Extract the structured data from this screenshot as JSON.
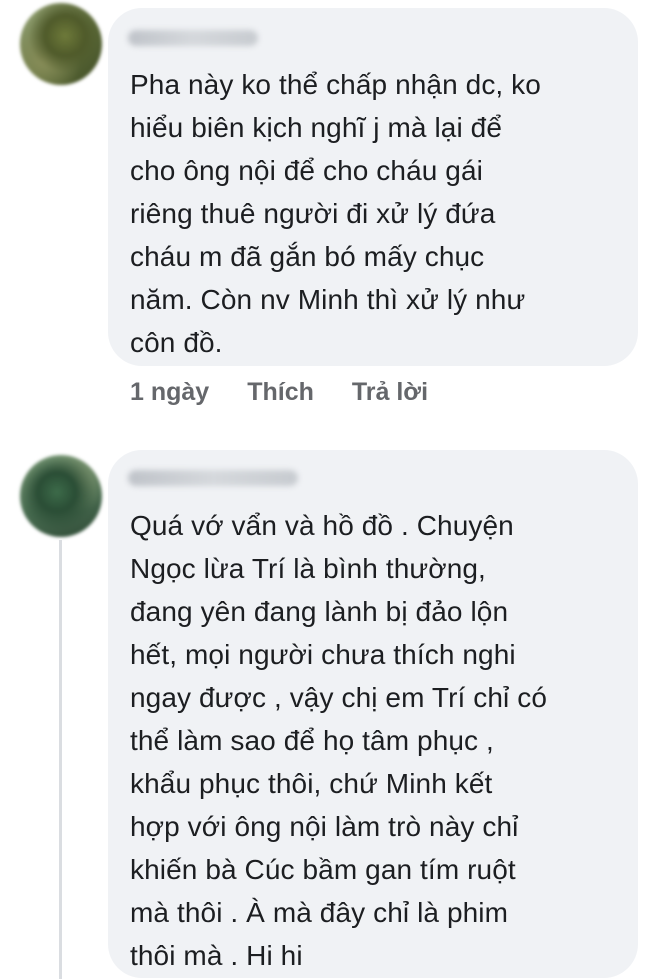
{
  "comments": [
    {
      "text": "Pha này ko thể chấp nhận dc, ko\nhiểu biên kịch nghĩ j mà lại để\ncho ông nội để cho cháu gái\nriêng thuê người đi xử lý đứa\ncháu m đã gắn bó mấy chục\nnăm. Còn nv Minh thì xử lý như\ncôn đồ.",
      "time": "1 ngày",
      "like_label": "Thích",
      "reply_label": "Trả lời"
    },
    {
      "text": "Quá vớ vẩn và hồ đồ . Chuyện\nNgọc lừa Trí là bình thường,\nđang yên đang lành bị đảo lộn\nhết, mọi người chưa thích nghi\nngay được , vậy chị em Trí chỉ có\nthể làm sao để họ tâm phục ,\nkhẩu phục thôi, chứ Minh kết\nhợp với ông nội làm trò này chỉ\nkhiến bà Cúc bầm gan tím ruột\nmà thôi . À mà đây chỉ là phim\nthôi mà . Hi hi"
    }
  ]
}
